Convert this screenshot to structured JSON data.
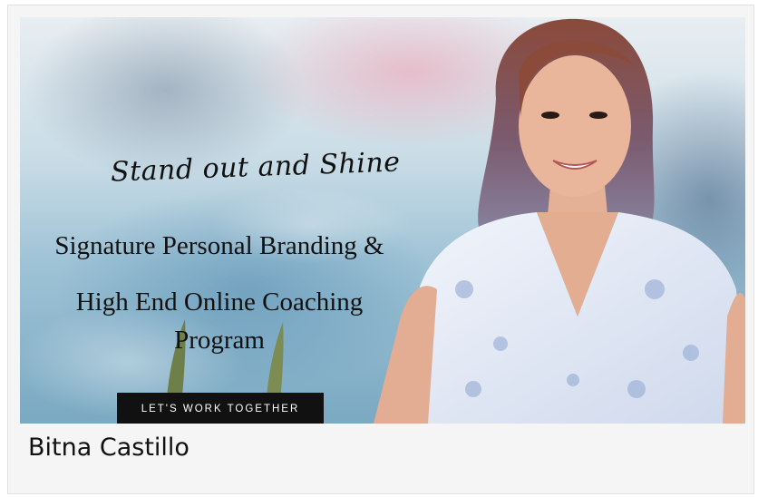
{
  "card": {
    "hero": {
      "script_title": "Stand out and Shine",
      "headline_line1": "Signature Personal Branding &",
      "headline_line2": "High End Online Coaching",
      "headline_line3": "Program",
      "cta_label": "LET'S WORK TOGETHER"
    },
    "name": "Bitna Castillo"
  },
  "colors": {
    "card_background": "#f5f5f5",
    "cta_background": "#111111",
    "cta_text": "#ffffff",
    "text": "#111111"
  }
}
